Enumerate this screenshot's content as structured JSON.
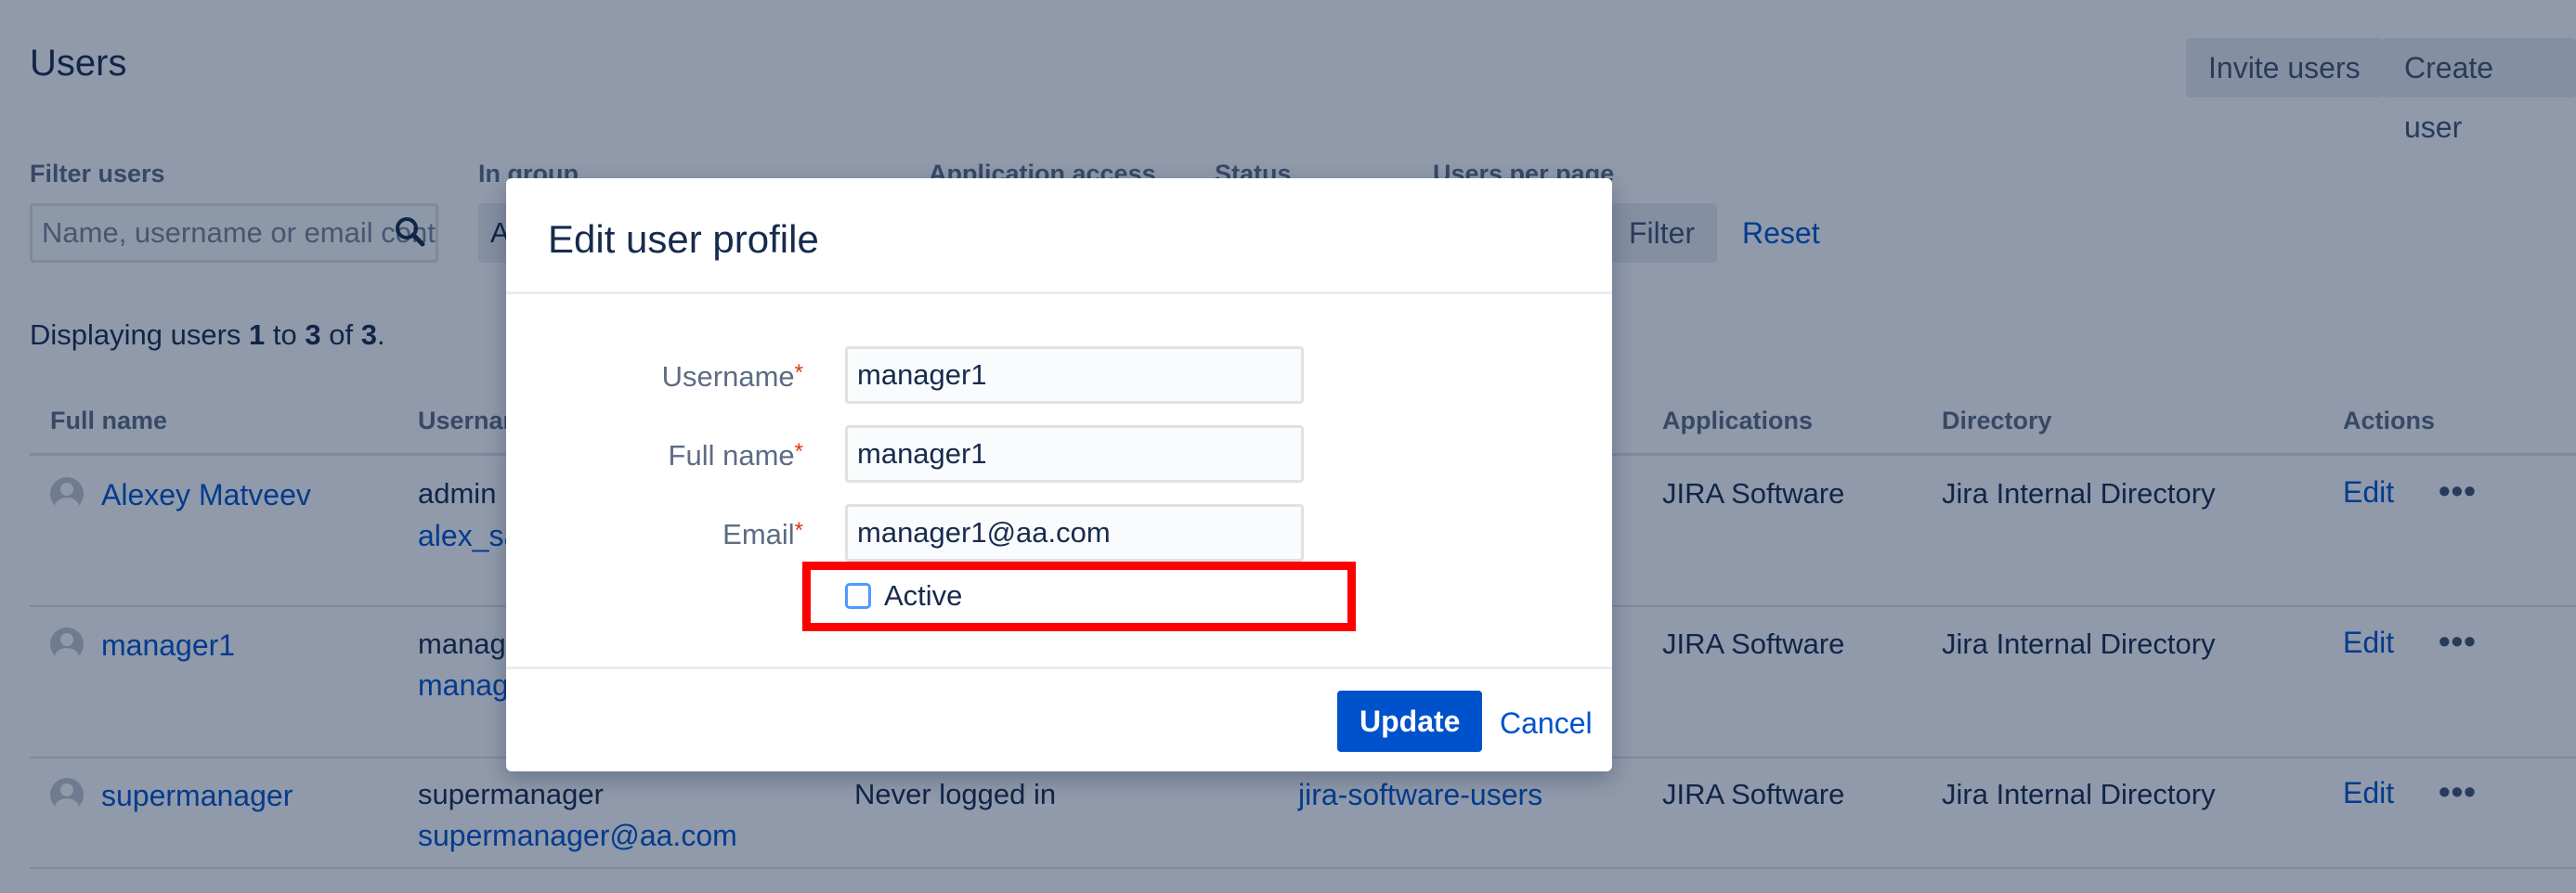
{
  "page": {
    "title": "Users",
    "invite_button": "Invite users",
    "create_button": "Create user"
  },
  "filters": {
    "filter_users_label": "Filter users",
    "filter_users_placeholder": "Name, username or email contains",
    "in_group_label": "In group",
    "in_group_value": "Any",
    "app_access_label": "Application access",
    "status_label": "Status",
    "per_page_label": "Users per page",
    "filter_button": "Filter",
    "reset_link": "Reset"
  },
  "summary": {
    "prefix": "Displaying users ",
    "from": "1",
    "mid": " to ",
    "to": "3",
    "of": " of ",
    "total": "3",
    "suffix": "."
  },
  "table": {
    "headers": {
      "full_name": "Full name",
      "username": "Username",
      "applications": "Applications",
      "directory": "Directory",
      "actions": "Actions"
    },
    "rows": [
      {
        "full_name": "Alexey Matveev",
        "username": "admin",
        "email": "alex_sa",
        "last_login": "",
        "group": "",
        "applications": "JIRA Software",
        "directory": "Jira Internal Directory",
        "edit": "Edit",
        "more": "•••"
      },
      {
        "full_name": "manager1",
        "username": "manag",
        "email": "manag",
        "last_login": "",
        "group": "",
        "applications": "JIRA Software",
        "directory": "Jira Internal Directory",
        "edit": "Edit",
        "more": "•••"
      },
      {
        "full_name": "supermanager",
        "username": "supermanager",
        "email": "supermanager@aa.com",
        "last_login": "Never logged in",
        "group": "jira-software-users",
        "applications": "JIRA Software",
        "directory": "Jira Internal Directory",
        "edit": "Edit",
        "more": "•••"
      }
    ]
  },
  "dialog": {
    "title": "Edit user profile",
    "username_label": "Username",
    "username_value": "manager1",
    "fullname_label": "Full name",
    "fullname_value": "manager1",
    "email_label": "Email",
    "email_value": "manager1@aa.com",
    "required_mark": "*",
    "active_label": "Active",
    "active_checked": false,
    "update_button": "Update",
    "cancel_link": "Cancel"
  },
  "colors": {
    "primary": "#0052cc",
    "highlight": "#ff0000",
    "overlay": "rgba(9,30,66,0.45)"
  }
}
